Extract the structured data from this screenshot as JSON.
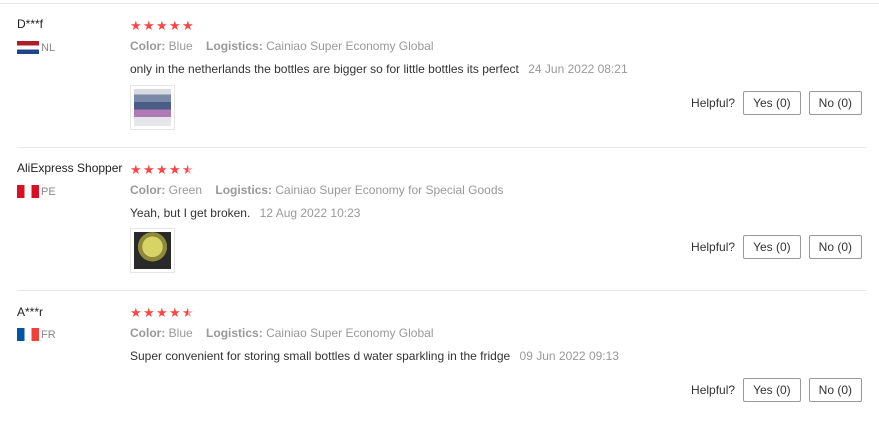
{
  "helpful_label": "Helpful?",
  "reviews": [
    {
      "user": "D***f",
      "country": "NL",
      "rating": 5,
      "color_label": "Color:",
      "color_value": "Blue",
      "logistics_label": "Logistics:",
      "logistics_value": "Cainiao Super Economy Global",
      "text": "only in the netherlands the bottles are bigger so for little bottles its perfect",
      "date": "24 Jun 2022 08:21",
      "yes_label": "Yes (0)",
      "no_label": "No (0)"
    },
    {
      "user": "AliExpress Shopper",
      "country": "PE",
      "rating": 4.5,
      "color_label": "Color:",
      "color_value": "Green",
      "logistics_label": "Logistics:",
      "logistics_value": "Cainiao Super Economy for Special Goods",
      "text": "Yeah, but I get broken.",
      "date": "12 Aug 2022 10:23",
      "yes_label": "Yes (0)",
      "no_label": "No (0)"
    },
    {
      "user": "A***r",
      "country": "FR",
      "rating": 4.5,
      "color_label": "Color:",
      "color_value": "Blue",
      "logistics_label": "Logistics:",
      "logistics_value": "Cainiao Super Economy Global",
      "text": "Super convenient for storing small bottles d water sparkling in the fridge",
      "date": "09 Jun 2022 09:13",
      "yes_label": "Yes (0)",
      "no_label": "No (0)"
    }
  ]
}
